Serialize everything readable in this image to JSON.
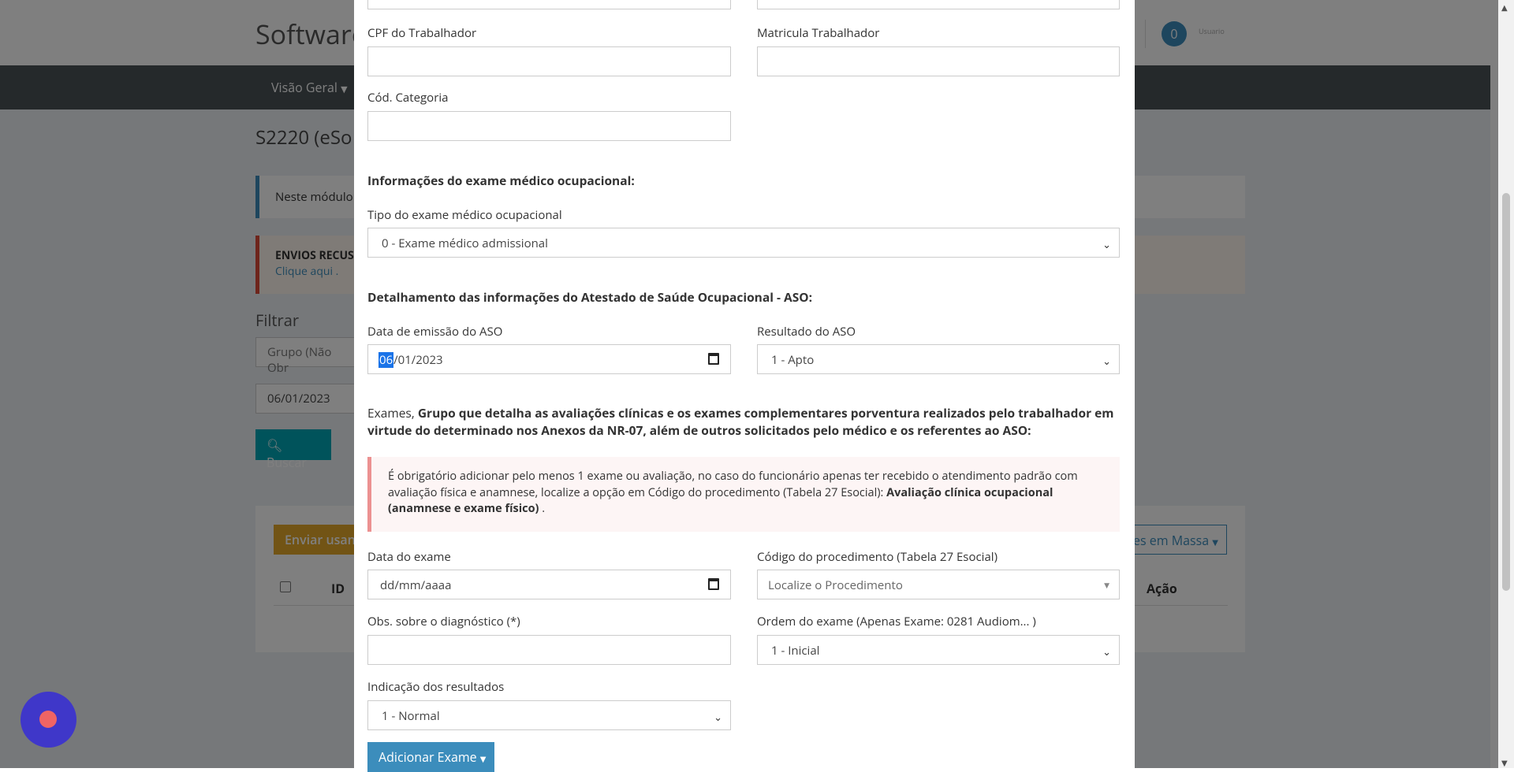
{
  "background": {
    "brand": "Software",
    "notification_count": "0",
    "tiny_text": "Usuario",
    "nav_item": "Visão Geral",
    "page_title": "S2220 (eSo",
    "info_alert": "Neste módulo v",
    "warn_alert_title": "ENVIOS RECUS",
    "warn_alert_link": "Clique aqui .",
    "filter_title": "Filtrar",
    "group_placeholder": "Grupo (Não Obr",
    "date_value": "06/01/2023",
    "search_button": "Buscar",
    "send_button": "Enviar usan",
    "bulk_button": "es em Massa",
    "table_headers": [
      "ID",
      "Ação"
    ]
  },
  "modal": {
    "cpf_label": "CPF do Trabalhador",
    "matricula_label": "Matricula Trabalhador",
    "categoria_label": "Cód. Categoria",
    "section_exam_info": "Informações do exame médico ocupacional:",
    "tipo_exame_label": "Tipo do exame médico ocupacional",
    "tipo_exame_value": "0 - Exame médico admissional",
    "section_aso": "Detalhamento das informações do Atestado de Saúde Ocupacional - ASO:",
    "data_emissao_label": "Data de emissão do ASO",
    "data_emissao_day": "06",
    "data_emissao_rest": "/01/2023",
    "resultado_label": "Resultado do ASO",
    "resultado_value": "1 - Apto",
    "exames_prefix": "Exames,",
    "exames_desc": "Grupo que detalha as avaliações clínicas e os exames complementares porventura realizados pelo trabalhador em virtude do determinado nos Anexos da NR-07, além de outros solicitados pelo médico e os referentes ao ASO:",
    "alert_text": "É obrigatório adicionar pelo menos 1 exame ou avaliação, no caso do funcionário apenas ter recebido o atendimento padrão com avaliação física e anamnese, localize a opção em Código do procedimento (Tabela 27 Esocial):",
    "alert_bold": "Avaliação clínica ocupacional (anamnese e exame físico)",
    "alert_tail": ".",
    "data_exame_label": "Data do exame",
    "data_exame_placeholder": "dd/mm/aaaa",
    "codigo_label": "Código do procedimento (Tabela 27 Esocial)",
    "codigo_placeholder": "Localize o Procedimento",
    "obs_label": "Obs. sobre o diagnóstico (*)",
    "ordem_label": "Ordem do exame (Apenas Exame: 0281 Audiom... )",
    "ordem_value": "1 - Inicial",
    "indicacao_label": "Indicação dos resultados",
    "indicacao_value": "1 - Normal",
    "add_button": "Adicionar Exame"
  }
}
